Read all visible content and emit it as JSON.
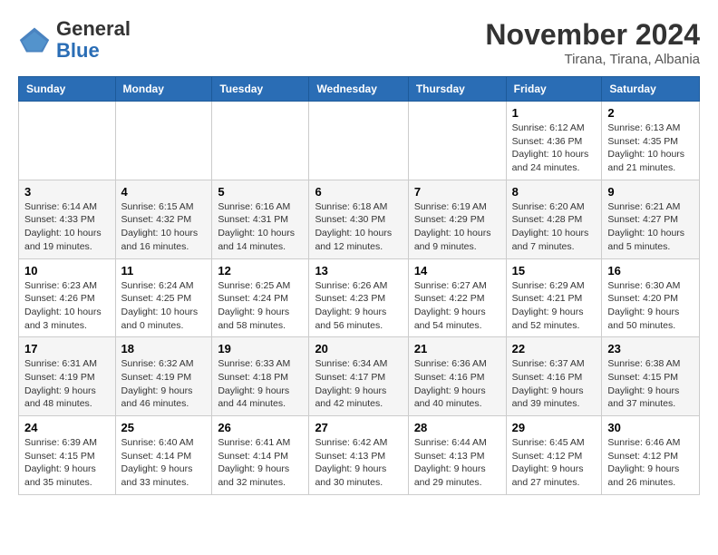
{
  "header": {
    "logo_general": "General",
    "logo_blue": "Blue",
    "month_year": "November 2024",
    "location": "Tirana, Tirana, Albania"
  },
  "days_of_week": [
    "Sunday",
    "Monday",
    "Tuesday",
    "Wednesday",
    "Thursday",
    "Friday",
    "Saturday"
  ],
  "weeks": [
    [
      {
        "day": "",
        "info": ""
      },
      {
        "day": "",
        "info": ""
      },
      {
        "day": "",
        "info": ""
      },
      {
        "day": "",
        "info": ""
      },
      {
        "day": "",
        "info": ""
      },
      {
        "day": "1",
        "info": "Sunrise: 6:12 AM\nSunset: 4:36 PM\nDaylight: 10 hours and 24 minutes."
      },
      {
        "day": "2",
        "info": "Sunrise: 6:13 AM\nSunset: 4:35 PM\nDaylight: 10 hours and 21 minutes."
      }
    ],
    [
      {
        "day": "3",
        "info": "Sunrise: 6:14 AM\nSunset: 4:33 PM\nDaylight: 10 hours and 19 minutes."
      },
      {
        "day": "4",
        "info": "Sunrise: 6:15 AM\nSunset: 4:32 PM\nDaylight: 10 hours and 16 minutes."
      },
      {
        "day": "5",
        "info": "Sunrise: 6:16 AM\nSunset: 4:31 PM\nDaylight: 10 hours and 14 minutes."
      },
      {
        "day": "6",
        "info": "Sunrise: 6:18 AM\nSunset: 4:30 PM\nDaylight: 10 hours and 12 minutes."
      },
      {
        "day": "7",
        "info": "Sunrise: 6:19 AM\nSunset: 4:29 PM\nDaylight: 10 hours and 9 minutes."
      },
      {
        "day": "8",
        "info": "Sunrise: 6:20 AM\nSunset: 4:28 PM\nDaylight: 10 hours and 7 minutes."
      },
      {
        "day": "9",
        "info": "Sunrise: 6:21 AM\nSunset: 4:27 PM\nDaylight: 10 hours and 5 minutes."
      }
    ],
    [
      {
        "day": "10",
        "info": "Sunrise: 6:23 AM\nSunset: 4:26 PM\nDaylight: 10 hours and 3 minutes."
      },
      {
        "day": "11",
        "info": "Sunrise: 6:24 AM\nSunset: 4:25 PM\nDaylight: 10 hours and 0 minutes."
      },
      {
        "day": "12",
        "info": "Sunrise: 6:25 AM\nSunset: 4:24 PM\nDaylight: 9 hours and 58 minutes."
      },
      {
        "day": "13",
        "info": "Sunrise: 6:26 AM\nSunset: 4:23 PM\nDaylight: 9 hours and 56 minutes."
      },
      {
        "day": "14",
        "info": "Sunrise: 6:27 AM\nSunset: 4:22 PM\nDaylight: 9 hours and 54 minutes."
      },
      {
        "day": "15",
        "info": "Sunrise: 6:29 AM\nSunset: 4:21 PM\nDaylight: 9 hours and 52 minutes."
      },
      {
        "day": "16",
        "info": "Sunrise: 6:30 AM\nSunset: 4:20 PM\nDaylight: 9 hours and 50 minutes."
      }
    ],
    [
      {
        "day": "17",
        "info": "Sunrise: 6:31 AM\nSunset: 4:19 PM\nDaylight: 9 hours and 48 minutes."
      },
      {
        "day": "18",
        "info": "Sunrise: 6:32 AM\nSunset: 4:19 PM\nDaylight: 9 hours and 46 minutes."
      },
      {
        "day": "19",
        "info": "Sunrise: 6:33 AM\nSunset: 4:18 PM\nDaylight: 9 hours and 44 minutes."
      },
      {
        "day": "20",
        "info": "Sunrise: 6:34 AM\nSunset: 4:17 PM\nDaylight: 9 hours and 42 minutes."
      },
      {
        "day": "21",
        "info": "Sunrise: 6:36 AM\nSunset: 4:16 PM\nDaylight: 9 hours and 40 minutes."
      },
      {
        "day": "22",
        "info": "Sunrise: 6:37 AM\nSunset: 4:16 PM\nDaylight: 9 hours and 39 minutes."
      },
      {
        "day": "23",
        "info": "Sunrise: 6:38 AM\nSunset: 4:15 PM\nDaylight: 9 hours and 37 minutes."
      }
    ],
    [
      {
        "day": "24",
        "info": "Sunrise: 6:39 AM\nSunset: 4:15 PM\nDaylight: 9 hours and 35 minutes."
      },
      {
        "day": "25",
        "info": "Sunrise: 6:40 AM\nSunset: 4:14 PM\nDaylight: 9 hours and 33 minutes."
      },
      {
        "day": "26",
        "info": "Sunrise: 6:41 AM\nSunset: 4:14 PM\nDaylight: 9 hours and 32 minutes."
      },
      {
        "day": "27",
        "info": "Sunrise: 6:42 AM\nSunset: 4:13 PM\nDaylight: 9 hours and 30 minutes."
      },
      {
        "day": "28",
        "info": "Sunrise: 6:44 AM\nSunset: 4:13 PM\nDaylight: 9 hours and 29 minutes."
      },
      {
        "day": "29",
        "info": "Sunrise: 6:45 AM\nSunset: 4:12 PM\nDaylight: 9 hours and 27 minutes."
      },
      {
        "day": "30",
        "info": "Sunrise: 6:46 AM\nSunset: 4:12 PM\nDaylight: 9 hours and 26 minutes."
      }
    ]
  ]
}
